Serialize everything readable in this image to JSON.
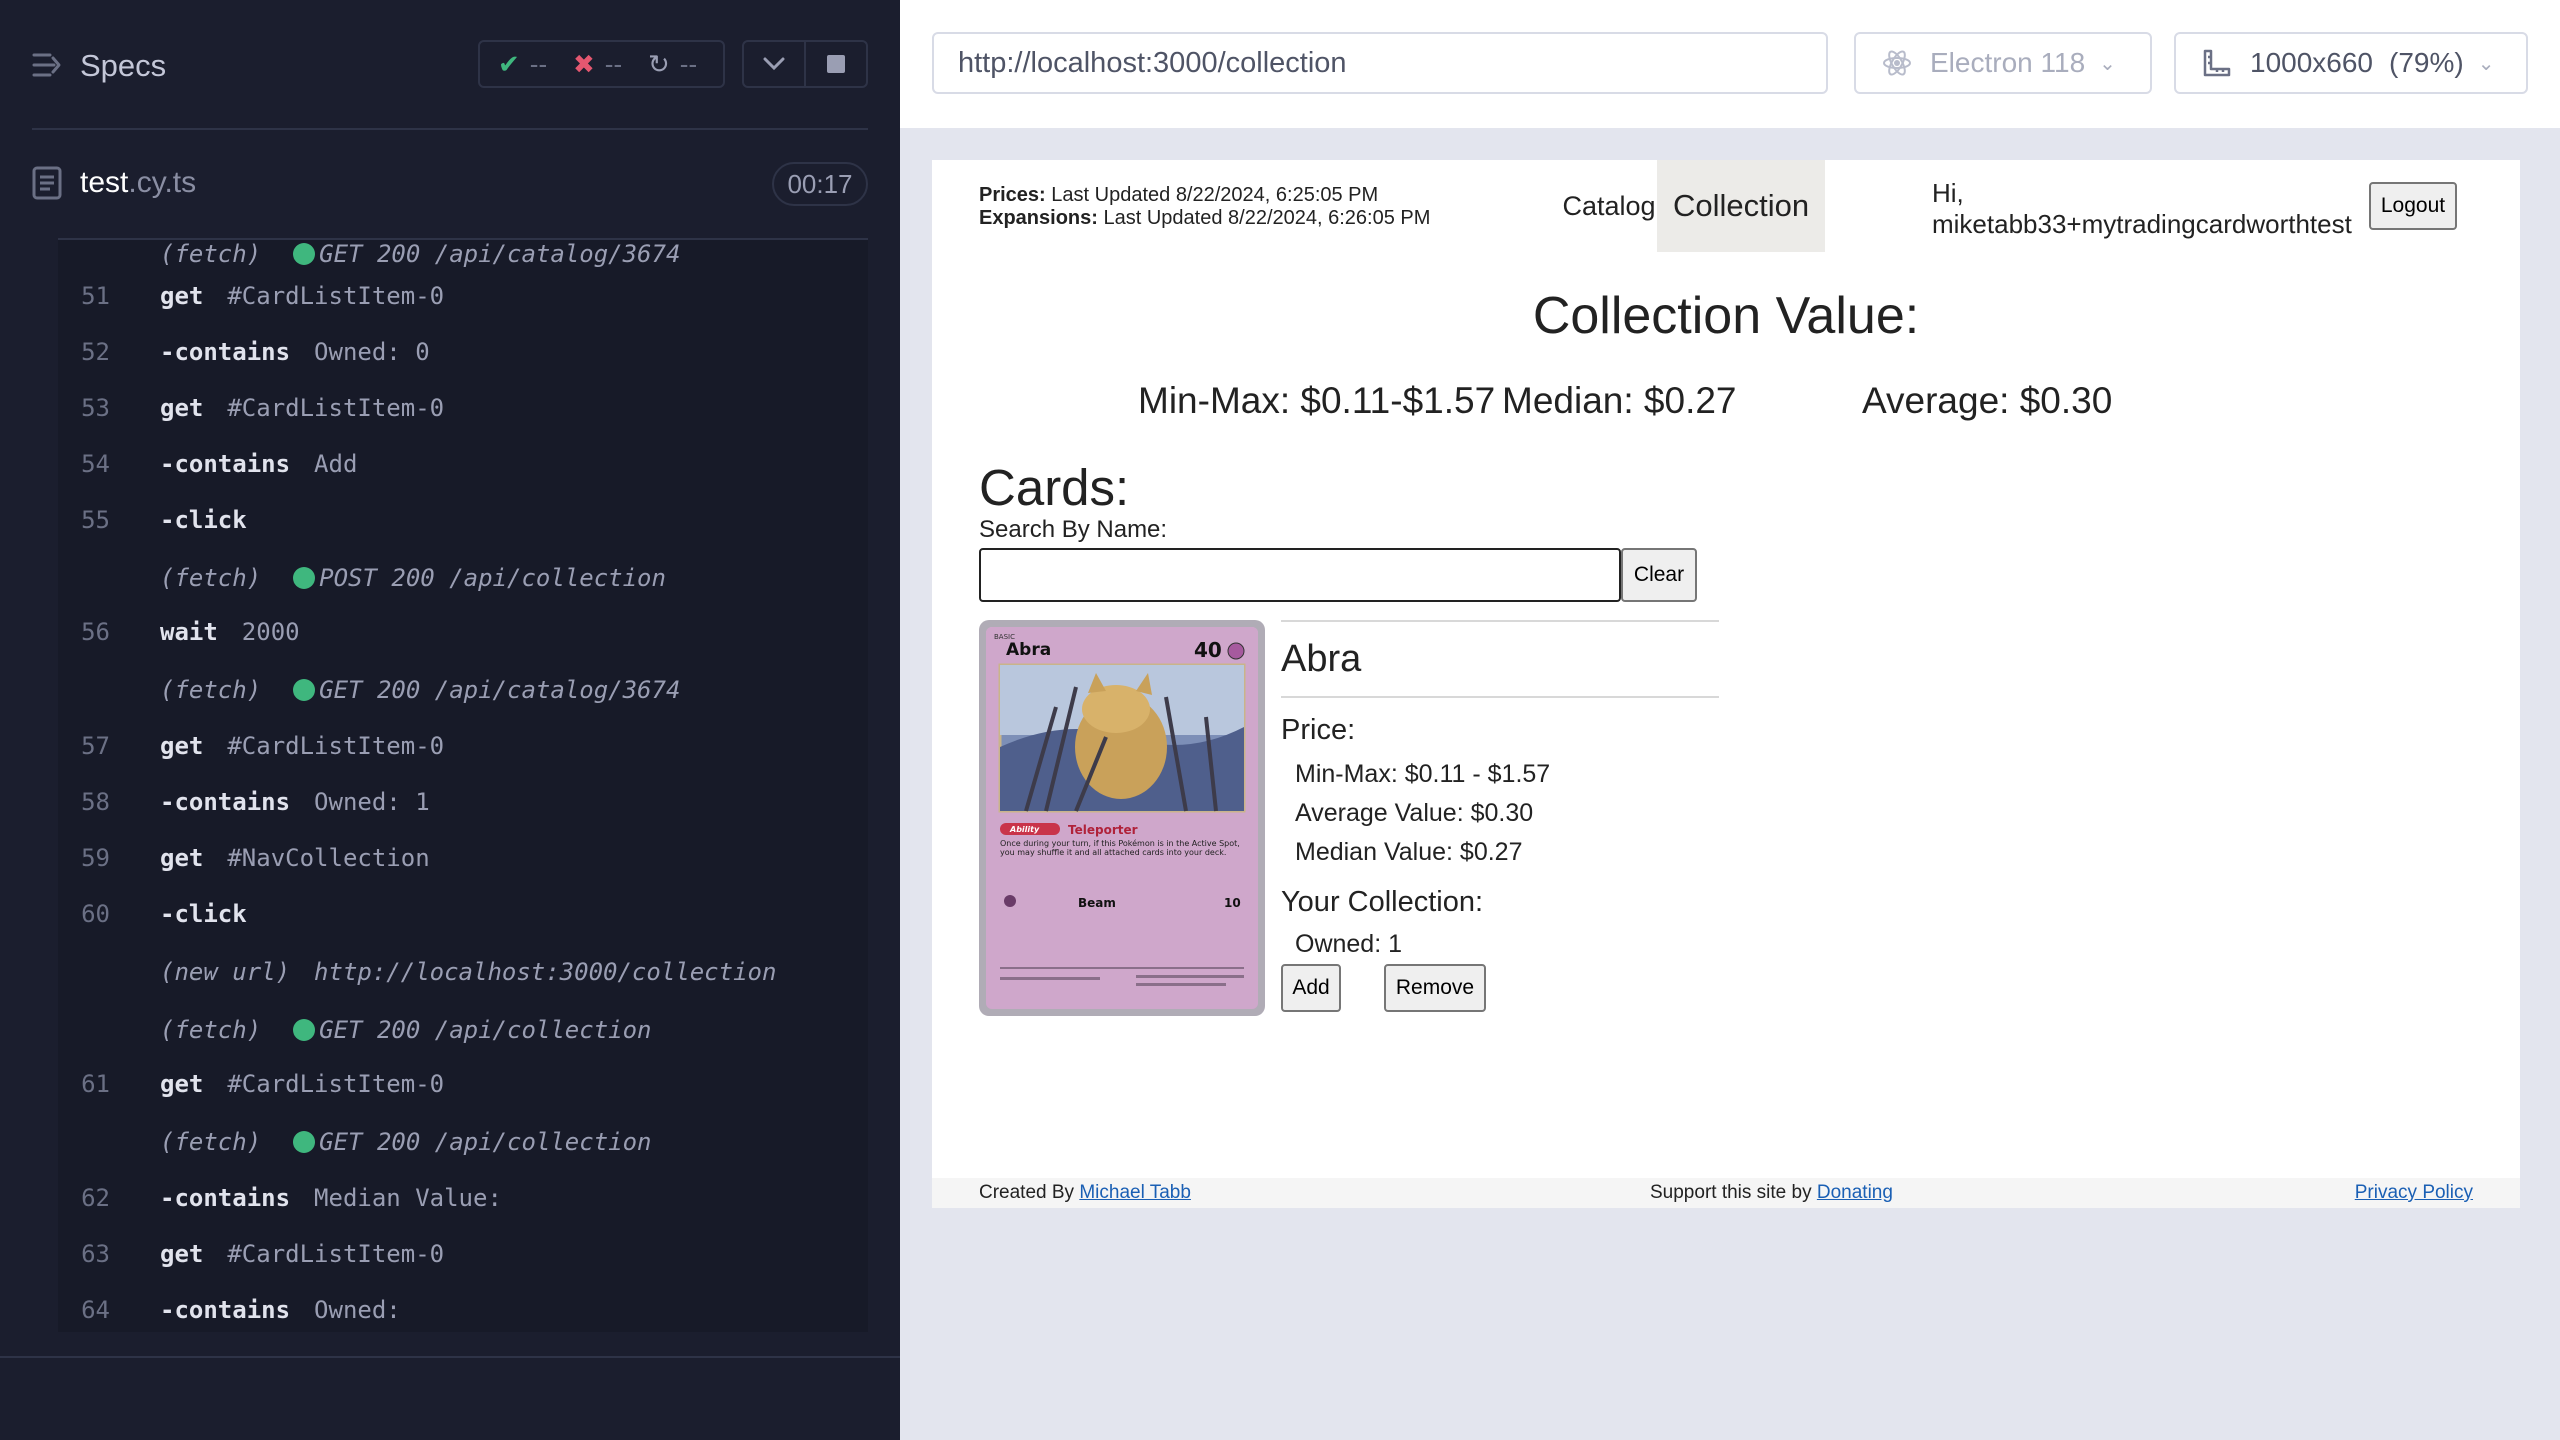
{
  "runner": {
    "specs_title": "Specs",
    "stats": {
      "passed": "--",
      "failed": "--",
      "pending": "--"
    },
    "file": {
      "name": "test",
      "ext": ".cy.ts"
    },
    "timer": "00:17",
    "log": [
      {
        "type": "event",
        "label": "(fetch)",
        "text": "GET 200 /api/catalog/3674",
        "dot": true
      },
      {
        "type": "cmd",
        "num": "51",
        "cmd": "get",
        "arg": "#CardListItem-0"
      },
      {
        "type": "cmd",
        "num": "52",
        "cmd": "-contains",
        "arg": "Owned: 0"
      },
      {
        "type": "cmd",
        "num": "53",
        "cmd": "get",
        "arg": "#CardListItem-0"
      },
      {
        "type": "cmd",
        "num": "54",
        "cmd": "-contains",
        "arg": "Add"
      },
      {
        "type": "cmd",
        "num": "55",
        "cmd": "-click",
        "arg": ""
      },
      {
        "type": "event",
        "label": "(fetch)",
        "text": "POST 200 /api/collection",
        "dot": true
      },
      {
        "type": "cmd",
        "num": "56",
        "cmd": "wait",
        "arg": "2000"
      },
      {
        "type": "event",
        "label": "(fetch)",
        "text": "GET 200 /api/catalog/3674",
        "dot": true
      },
      {
        "type": "cmd",
        "num": "57",
        "cmd": "get",
        "arg": "#CardListItem-0"
      },
      {
        "type": "cmd",
        "num": "58",
        "cmd": "-contains",
        "arg": "Owned: 1"
      },
      {
        "type": "cmd",
        "num": "59",
        "cmd": "get",
        "arg": "#NavCollection"
      },
      {
        "type": "cmd",
        "num": "60",
        "cmd": "-click",
        "arg": ""
      },
      {
        "type": "event",
        "label": "(new url)",
        "text": "http://localhost:3000/collection",
        "dot": false
      },
      {
        "type": "event",
        "label": "(fetch)",
        "text": "GET 200 /api/collection",
        "dot": true
      },
      {
        "type": "cmd",
        "num": "61",
        "cmd": "get",
        "arg": "#CardListItem-0"
      },
      {
        "type": "event",
        "label": "(fetch)",
        "text": "GET 200 /api/collection",
        "dot": true
      },
      {
        "type": "cmd",
        "num": "62",
        "cmd": "-contains",
        "arg": "Median Value:"
      },
      {
        "type": "cmd",
        "num": "63",
        "cmd": "get",
        "arg": "#CardListItem-0"
      },
      {
        "type": "cmd",
        "num": "64",
        "cmd": "-contains",
        "arg": "Owned:"
      }
    ]
  },
  "browser": {
    "url": "http://localhost:3000/collection",
    "browser_name": "Electron 118",
    "viewport": "1000x660",
    "zoom": "(79%)"
  },
  "app": {
    "prices_label": "Prices:",
    "prices_updated": "Last Updated 8/22/2024, 6:25:05 PM",
    "expansions_label": "Expansions:",
    "expansions_updated": "Last Updated 8/22/2024, 6:26:05 PM",
    "nav_catalog": "Catalog",
    "nav_collection": "Collection",
    "greeting_hi": "Hi,",
    "greeting_user": "miketabb33+mytradingcardworthtest",
    "logout": "Logout",
    "collection_value_title": "Collection Value:",
    "minmax": "Min-Max: $0.11-$1.57",
    "median": "Median: $0.27",
    "average": "Average: $0.30",
    "cards_heading": "Cards:",
    "search_label": "Search By Name:",
    "search_value": "",
    "clear": "Clear",
    "card": {
      "name": "Abra",
      "price_heading": "Price:",
      "minmax": "Min-Max: $0.11 - $1.57",
      "average": "Average Value: $0.30",
      "median": "Median Value: $0.27",
      "collection_heading": "Your Collection:",
      "owned": "Owned: 1",
      "add": "Add",
      "remove": "Remove",
      "image_text": {
        "stage": "BASIC",
        "name": "Abra",
        "hp": "40",
        "ability_tag": "Ability",
        "ability": "Teleporter",
        "ability_text": "Once during your turn, if this Pokémon is in the Active Spot, you may shuffle it and all attached cards into your deck.",
        "attack": "Beam",
        "damage": "10"
      }
    },
    "footer": {
      "created_by": "Created By",
      "author": "Michael Tabb",
      "support": "Support this site by",
      "donating": "Donating",
      "privacy": "Privacy Policy"
    }
  }
}
